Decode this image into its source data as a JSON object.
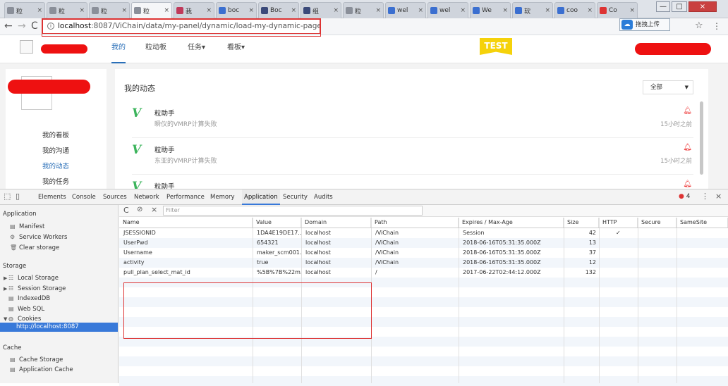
{
  "browser": {
    "tabs": [
      {
        "label": "粒",
        "icon": "page-icon",
        "color": "#8a8f99",
        "active": false
      },
      {
        "label": "粒",
        "icon": "page-icon",
        "color": "#8a8f99",
        "active": false
      },
      {
        "label": "粒",
        "icon": "page-icon",
        "color": "#8a8f99",
        "active": false
      },
      {
        "label": "粒",
        "icon": "page-icon",
        "color": "#8a8f99",
        "active": true
      },
      {
        "label": "我",
        "icon": "r-icon",
        "color": "#c0395a",
        "active": false
      },
      {
        "label": "boc",
        "icon": "paw-icon",
        "color": "#3b6fd0",
        "active": false
      },
      {
        "label": "Boc",
        "icon": "b-icon",
        "color": "#3b4a7a",
        "active": false
      },
      {
        "label": "组",
        "icon": "b-icon",
        "color": "#3b4a7a",
        "active": false
      },
      {
        "label": "粒",
        "icon": "page-icon",
        "color": "#8a8f99",
        "active": false
      },
      {
        "label": "wel",
        "icon": "paw-icon",
        "color": "#3b6fd0",
        "active": false
      },
      {
        "label": "wel",
        "icon": "paw-icon",
        "color": "#3b6fd0",
        "active": false
      },
      {
        "label": "We",
        "icon": "edge-icon",
        "color": "#3b6fd0",
        "active": false
      },
      {
        "label": "软",
        "icon": "paw-icon",
        "color": "#3b6fd0",
        "active": false
      },
      {
        "label": "coo",
        "icon": "paw-icon",
        "color": "#3b6fd0",
        "active": false
      },
      {
        "label": "Co",
        "icon": "csdn-icon",
        "color": "#d33",
        "active": false
      }
    ],
    "tab_close": "×",
    "window_controls": {
      "minimize": "—",
      "maximize": "□",
      "close": "×"
    },
    "url_host": "localhost",
    "url_path": ":8087/ViChain/data/my-panel/dynamic/load-my-dynamic-page",
    "upload_label": "拖拽上传",
    "star": "☆",
    "menu": "⋮"
  },
  "site": {
    "nav": [
      {
        "label": "我的",
        "active": true
      },
      {
        "label": "粒动板",
        "active": false
      },
      {
        "label": "任务▾",
        "active": false
      },
      {
        "label": "看板▾",
        "active": false
      }
    ],
    "badge": "TEST",
    "sidebar_links": [
      {
        "label": "我的看板",
        "active": false
      },
      {
        "label": "我的沟通",
        "active": false
      },
      {
        "label": "我的动态",
        "active": true
      },
      {
        "label": "我的任务",
        "active": false
      }
    ],
    "feed_title": "我的动态",
    "filter_value": "全部",
    "dynamics": [
      {
        "sender": "粒助手",
        "message": "瞬仪的VMRP计算失败",
        "time": "15小时之前"
      },
      {
        "sender": "粒助手",
        "message": "东亚的VMRP计算失败",
        "time": "15小时之前"
      },
      {
        "sender": "粒助手",
        "message": "",
        "time": ""
      }
    ]
  },
  "devtools": {
    "tabs": [
      "Elements",
      "Console",
      "Sources",
      "Network",
      "Performance",
      "Memory",
      "Application",
      "Security",
      "Audits"
    ],
    "active_tab": "Application",
    "error_count": "4",
    "sidebar": {
      "application_header": "Application",
      "application_items": [
        "Manifest",
        "Service Workers",
        "Clear storage"
      ],
      "storage_header": "Storage",
      "storage_items": [
        "Local Storage",
        "Session Storage",
        "IndexedDB",
        "Web SQL",
        "Cookies"
      ],
      "cookie_origin": "http://localhost:8087",
      "cache_header": "Cache",
      "cache_items": [
        "Cache Storage",
        "Application Cache"
      ]
    },
    "filter_placeholder": "Filter",
    "columns": [
      "Name",
      "Value",
      "Domain",
      "Path",
      "Expires / Max-Age",
      "Size",
      "HTTP",
      "Secure",
      "SameSite"
    ],
    "cookies": [
      {
        "name": "JSESSIONID",
        "value": "1DA4E19DE17...",
        "domain": "localhost",
        "path": "/ViChain",
        "expires": "Session",
        "size": "42",
        "http": "✓",
        "secure": "",
        "samesite": ""
      },
      {
        "name": "UserPwd",
        "value": "654321",
        "domain": "localhost",
        "path": "/ViChain",
        "expires": "2018-06-16T05:31:35.000Z",
        "size": "13",
        "http": "",
        "secure": "",
        "samesite": ""
      },
      {
        "name": "Username",
        "value": "maker_scm001...",
        "domain": "localhost",
        "path": "/ViChain",
        "expires": "2018-06-16T05:31:35.000Z",
        "size": "37",
        "http": "",
        "secure": "",
        "samesite": ""
      },
      {
        "name": "activity",
        "value": "true",
        "domain": "localhost",
        "path": "/ViChain",
        "expires": "2018-06-16T05:31:35.000Z",
        "size": "12",
        "http": "",
        "secure": "",
        "samesite": ""
      },
      {
        "name": "pull_plan_select_mat_id",
        "value": "%5B%7B%22m...",
        "domain": "localhost",
        "path": "/",
        "expires": "2017-06-22T02:44:12.000Z",
        "size": "132",
        "http": "",
        "secure": "",
        "samesite": ""
      }
    ]
  },
  "colors": {
    "accent": "#3879d9",
    "link": "#2a6fb8",
    "annotation": "#d33",
    "redaction": "#ee1111",
    "badge": "#f5d20b",
    "check": "#3cb45c"
  }
}
